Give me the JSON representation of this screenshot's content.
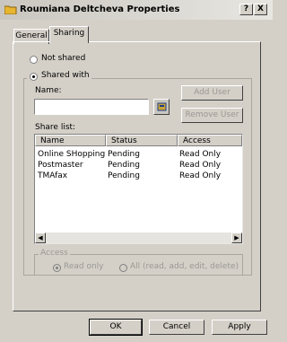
{
  "window": {
    "title": "Roumiana Deltcheva  Properties",
    "help_label": "?",
    "close_label": "X"
  },
  "tabs": [
    {
      "label": "General",
      "selected": false
    },
    {
      "label": "Sharing",
      "selected": true
    }
  ],
  "sharing": {
    "not_shared_label": "Not shared",
    "shared_with_label": "Shared with",
    "selected_option": "Shared with",
    "name_label": "Name:",
    "name_value": "",
    "add_user_label": "Add User",
    "remove_user_label": "Remove User",
    "share_list_label": "Share list:",
    "columns": [
      "Name",
      "Status",
      "Access"
    ],
    "rows": [
      {
        "name": "Online SHopping",
        "status": "Pending",
        "access": "Read Only"
      },
      {
        "name": "Postmaster",
        "status": "Pending",
        "access": "Read Only"
      },
      {
        "name": "TMAfax",
        "status": "Pending",
        "access": "Read Only"
      }
    ],
    "access_group_label": "Access",
    "read_only_label": "Read only",
    "all_label": "All (read, add, edit, delete)"
  },
  "footer": {
    "ok_label": "OK",
    "cancel_label": "Cancel",
    "apply_label": "Apply"
  },
  "icons": {
    "title": "folder-icon",
    "address_book": "address-book-icon",
    "scroll_left": "scroll-left-icon",
    "scroll_right": "scroll-right-icon"
  },
  "colors": {
    "face": "#d4d0c8",
    "folder": "#e8b531",
    "address_book": "#c9a436"
  }
}
